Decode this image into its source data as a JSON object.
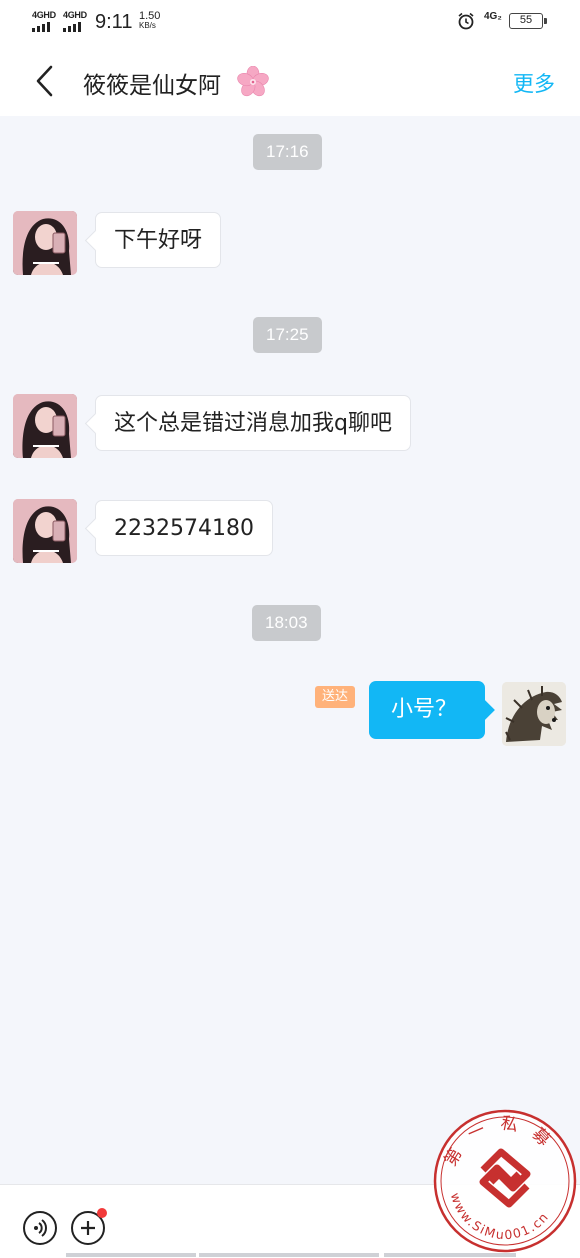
{
  "status_bar": {
    "sim1": "4GHD",
    "sim2": "4GHD",
    "time": "9:11",
    "speed_value": "1.50",
    "speed_unit": "KB/s",
    "network": "4G₂",
    "battery": "55"
  },
  "header": {
    "title": "筱筱是仙女阿",
    "more": "更多"
  },
  "messages": [
    {
      "type": "time",
      "text": "17:16"
    },
    {
      "type": "incoming",
      "text": "下午好呀"
    },
    {
      "type": "time",
      "text": "17:25"
    },
    {
      "type": "incoming",
      "text": "这个总是错过消息加我q聊吧"
    },
    {
      "type": "incoming",
      "text": "2232574180"
    },
    {
      "type": "time",
      "text": "18:03"
    },
    {
      "type": "outgoing",
      "text": "小号？",
      "status": "送达"
    }
  ],
  "watermark": {
    "top_text": "第一私募",
    "bottom_text": "www.SiMu001.cn"
  },
  "colors": {
    "accent": "#12b7f5",
    "delivered_badge": "#ffb27a",
    "chat_bg": "#f4f6fb",
    "stamp_red": "#c7302f"
  }
}
